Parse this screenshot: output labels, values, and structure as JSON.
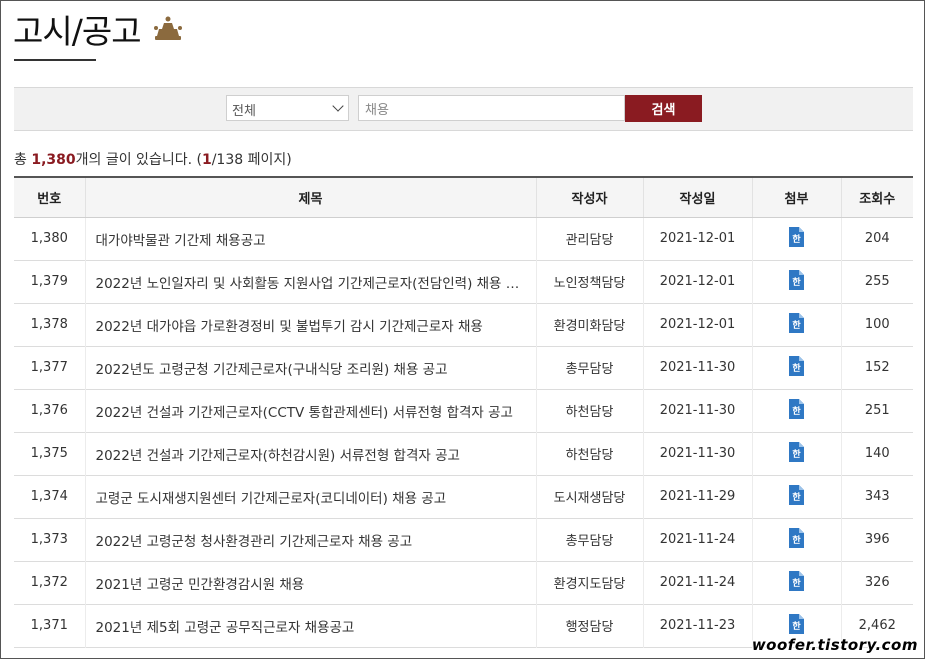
{
  "page": {
    "title": "고시/공고"
  },
  "search": {
    "select_value": "전체",
    "input_value": "채용",
    "button_label": "검색"
  },
  "summary": {
    "prefix": "총 ",
    "total": "1,380",
    "mid": "개의 글이 있습니다. (",
    "current_page": "1",
    "suffix": "/138 페이지)"
  },
  "table": {
    "headers": [
      "번호",
      "제목",
      "작성자",
      "작성일",
      "첨부",
      "조회수"
    ],
    "rows": [
      {
        "num": "1,380",
        "title": "대가야박물관 기간제 채용공고",
        "author": "관리담당",
        "date": "2021-12-01",
        "views": "204"
      },
      {
        "num": "1,379",
        "title": "2022년 노인일자리 및 사회활동 지원사업 기간제근로자(전담인력) 채용 …",
        "author": "노인정책담당",
        "date": "2021-12-01",
        "views": "255"
      },
      {
        "num": "1,378",
        "title": "2022년 대가야읍 가로환경정비 및 불법투기 감시 기간제근로자 채용",
        "author": "환경미화담당",
        "date": "2021-12-01",
        "views": "100"
      },
      {
        "num": "1,377",
        "title": "2022년도 고령군청 기간제근로자(구내식당 조리원) 채용 공고",
        "author": "총무담당",
        "date": "2021-11-30",
        "views": "152"
      },
      {
        "num": "1,376",
        "title": "2022년 건설과 기간제근로자(CCTV 통합관제센터) 서류전형 합격자 공고",
        "author": "하천담당",
        "date": "2021-11-30",
        "views": "251"
      },
      {
        "num": "1,375",
        "title": "2022년 건설과 기간제근로자(하천감시원) 서류전형 합격자 공고",
        "author": "하천담당",
        "date": "2021-11-30",
        "views": "140"
      },
      {
        "num": "1,374",
        "title": "고령군 도시재생지원센터 기간제근로자(코디네이터) 채용 공고",
        "author": "도시재생담당",
        "date": "2021-11-29",
        "views": "343"
      },
      {
        "num": "1,373",
        "title": "2022년 고령군청 청사환경관리 기간제근로자 채용 공고",
        "author": "총무담당",
        "date": "2021-11-24",
        "views": "396"
      },
      {
        "num": "1,372",
        "title": "2021년 고령군 민간환경감시원 채용",
        "author": "환경지도담당",
        "date": "2021-11-24",
        "views": "326"
      },
      {
        "num": "1,371",
        "title": "2021년 제5회 고령군 공무직근로자 채용공고",
        "author": "행정담당",
        "date": "2021-11-23",
        "views": "2,462"
      }
    ]
  },
  "watermark": "woofer.tistory.com",
  "colors": {
    "accent": "#8a1b21",
    "file_icon": "#2f78c4"
  }
}
